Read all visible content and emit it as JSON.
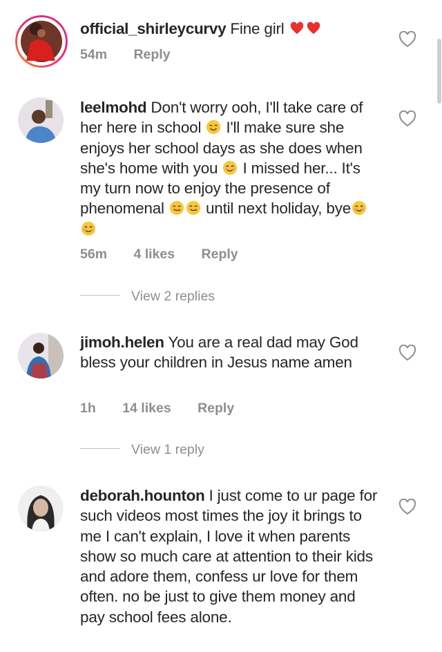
{
  "comments": [
    {
      "username": "official_shirleycurvy",
      "text": " Fine girl ",
      "emoji_after": [
        "red-heart-emoji",
        "red-heart-emoji"
      ],
      "time": "54m",
      "likes": "",
      "reply_label": "Reply",
      "avatar_colors": {
        "bg": "#8a2a1e",
        "figure": "#d8201e"
      }
    },
    {
      "username": "leelmohd",
      "text_segments": [
        " Don't worry ooh, I'll take care of her here in school ",
        " I'll make sure she enjoys her school days as she does when she's home with you ",
        " I missed her... It's my turn now to enjoy the presence of phenomenal ",
        " until next holiday, bye"
      ],
      "time": "56m",
      "likes": "4 likes",
      "reply_label": "Reply",
      "view_replies": "View 2 replies"
    },
    {
      "username": "jimoh.helen",
      "text": " You are a real dad may God bless your children in Jesus name amen",
      "time": "1h",
      "likes": "14 likes",
      "reply_label": "Reply",
      "view_replies": "View 1 reply"
    },
    {
      "username": "deborah.hounton",
      "text": " I just come to ur page for such videos most times the joy it brings to me I can't explain, I love it when parents show so much care at attention to their kids and adore them, confess ur love for them often. no be just to give them money and pay school fees alone."
    }
  ],
  "colors": {
    "text": "#262626",
    "secondary": "#8e8e8e",
    "heart_outline": "#8e8e8e",
    "story_ring_start": "#f58529",
    "story_ring_end": "#dd2a7b"
  }
}
